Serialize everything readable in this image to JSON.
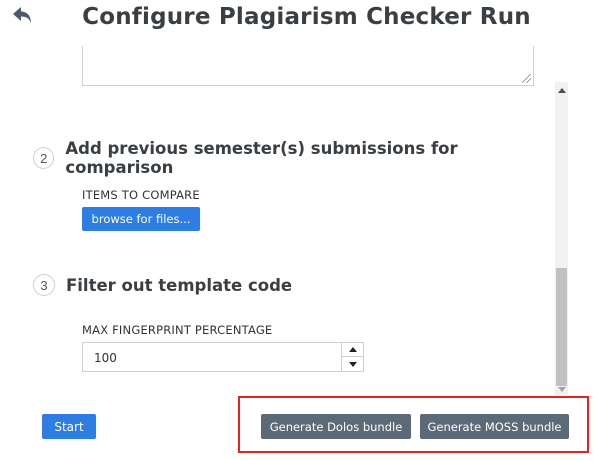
{
  "header": {
    "title": "Configure Plagiarism Checker Run",
    "back_icon": "back-arrow-icon"
  },
  "steps": [
    {
      "number": "2",
      "title": "Add previous semester(s) submissions for comparison",
      "field_label": "ITEMS TO COMPARE",
      "button_label": "browse for files..."
    },
    {
      "number": "3",
      "title": "Filter out template code",
      "field_label": "MAX FINGERPRINT PERCENTAGE",
      "input_value": "100"
    }
  ],
  "footer": {
    "start_label": "Start",
    "dolos_label": "Generate Dolos bundle",
    "moss_label": "Generate MOSS bundle"
  },
  "colors": {
    "primary_button": "#2d7de3",
    "secondary_button": "#5c6977",
    "highlight": "#e02424",
    "title_text": "#3a3f44"
  }
}
